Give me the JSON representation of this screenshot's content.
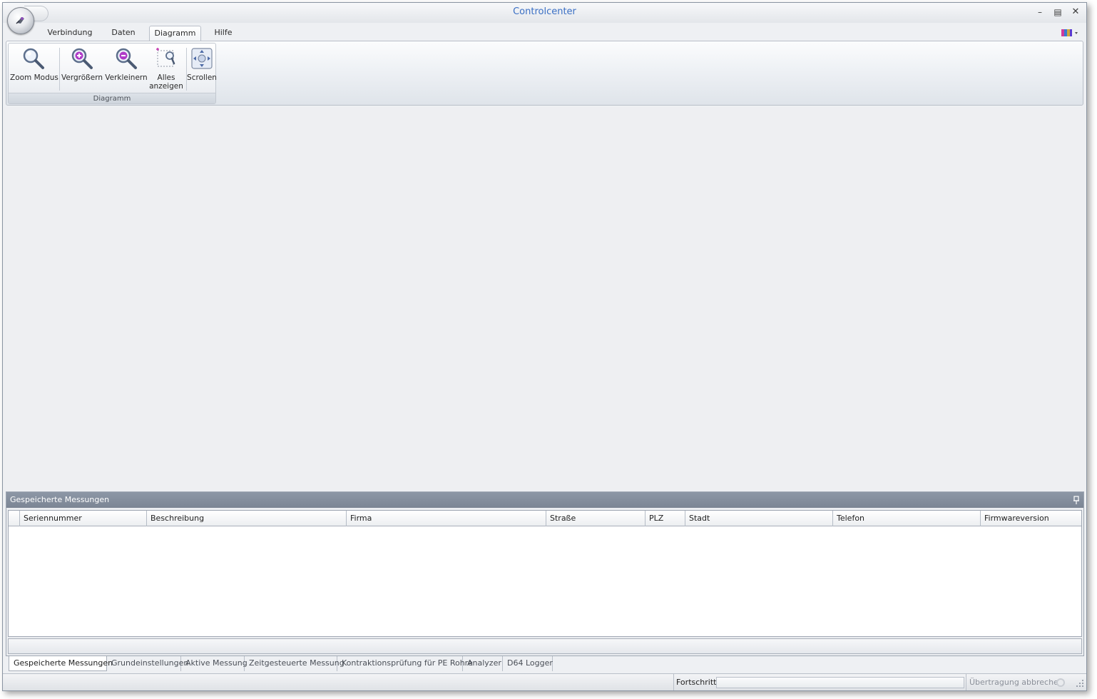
{
  "window": {
    "title": "Controlcenter"
  },
  "ribbon": {
    "tabs": [
      {
        "label": "Verbindung"
      },
      {
        "label": "Daten"
      },
      {
        "label": "Diagramm",
        "active": true
      },
      {
        "label": "Hilfe"
      }
    ],
    "group": {
      "label": "Diagramm",
      "buttons": [
        {
          "label": "Zoom Modus",
          "icon": "magnifier-icon"
        },
        {
          "label": "Vergrößern",
          "icon": "zoom-in-icon"
        },
        {
          "label": "Verkleinern",
          "icon": "zoom-out-icon"
        },
        {
          "label_line1": "Alles",
          "label_line2": "anzeigen",
          "icon": "zoom-fit-icon"
        },
        {
          "label": "Scrollen",
          "icon": "pan-icon"
        }
      ]
    }
  },
  "panel": {
    "title": "Gespeicherte Messungen",
    "columns": [
      "Seriennummer",
      "Beschreibung",
      "Firma",
      "Straße",
      "PLZ",
      "Stadt",
      "Telefon",
      "Firmwareversion"
    ],
    "rows": []
  },
  "bottom_tabs": [
    {
      "label": "Gespeicherte Messungen",
      "active": true
    },
    {
      "label": "Grundeinstellungen"
    },
    {
      "label": "Aktive Messung"
    },
    {
      "label": "Zeitgesteuerte Messung"
    },
    {
      "label": "Kontraktionsprüfung für PE Rohre"
    },
    {
      "label": "Analyzer"
    },
    {
      "label": "D64 Logger"
    }
  ],
  "statusbar": {
    "progress_label": "Fortschritt",
    "progress": 0,
    "cancel_label": "Übertragung abbrechen"
  },
  "colors": {
    "title_text": "#3a6fc4",
    "panel_header": "#7b8594"
  }
}
